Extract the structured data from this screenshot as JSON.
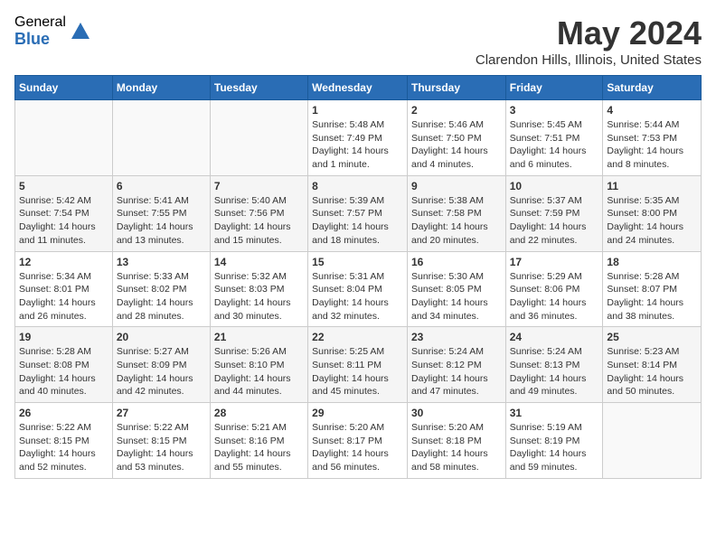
{
  "logo": {
    "general": "General",
    "blue": "Blue"
  },
  "title": "May 2024",
  "location": "Clarendon Hills, Illinois, United States",
  "weekdays": [
    "Sunday",
    "Monday",
    "Tuesday",
    "Wednesday",
    "Thursday",
    "Friday",
    "Saturday"
  ],
  "weeks": [
    [
      {
        "day": "",
        "info": ""
      },
      {
        "day": "",
        "info": ""
      },
      {
        "day": "",
        "info": ""
      },
      {
        "day": "1",
        "info": "Sunrise: 5:48 AM\nSunset: 7:49 PM\nDaylight: 14 hours\nand 1 minute."
      },
      {
        "day": "2",
        "info": "Sunrise: 5:46 AM\nSunset: 7:50 PM\nDaylight: 14 hours\nand 4 minutes."
      },
      {
        "day": "3",
        "info": "Sunrise: 5:45 AM\nSunset: 7:51 PM\nDaylight: 14 hours\nand 6 minutes."
      },
      {
        "day": "4",
        "info": "Sunrise: 5:44 AM\nSunset: 7:53 PM\nDaylight: 14 hours\nand 8 minutes."
      }
    ],
    [
      {
        "day": "5",
        "info": "Sunrise: 5:42 AM\nSunset: 7:54 PM\nDaylight: 14 hours\nand 11 minutes."
      },
      {
        "day": "6",
        "info": "Sunrise: 5:41 AM\nSunset: 7:55 PM\nDaylight: 14 hours\nand 13 minutes."
      },
      {
        "day": "7",
        "info": "Sunrise: 5:40 AM\nSunset: 7:56 PM\nDaylight: 14 hours\nand 15 minutes."
      },
      {
        "day": "8",
        "info": "Sunrise: 5:39 AM\nSunset: 7:57 PM\nDaylight: 14 hours\nand 18 minutes."
      },
      {
        "day": "9",
        "info": "Sunrise: 5:38 AM\nSunset: 7:58 PM\nDaylight: 14 hours\nand 20 minutes."
      },
      {
        "day": "10",
        "info": "Sunrise: 5:37 AM\nSunset: 7:59 PM\nDaylight: 14 hours\nand 22 minutes."
      },
      {
        "day": "11",
        "info": "Sunrise: 5:35 AM\nSunset: 8:00 PM\nDaylight: 14 hours\nand 24 minutes."
      }
    ],
    [
      {
        "day": "12",
        "info": "Sunrise: 5:34 AM\nSunset: 8:01 PM\nDaylight: 14 hours\nand 26 minutes."
      },
      {
        "day": "13",
        "info": "Sunrise: 5:33 AM\nSunset: 8:02 PM\nDaylight: 14 hours\nand 28 minutes."
      },
      {
        "day": "14",
        "info": "Sunrise: 5:32 AM\nSunset: 8:03 PM\nDaylight: 14 hours\nand 30 minutes."
      },
      {
        "day": "15",
        "info": "Sunrise: 5:31 AM\nSunset: 8:04 PM\nDaylight: 14 hours\nand 32 minutes."
      },
      {
        "day": "16",
        "info": "Sunrise: 5:30 AM\nSunset: 8:05 PM\nDaylight: 14 hours\nand 34 minutes."
      },
      {
        "day": "17",
        "info": "Sunrise: 5:29 AM\nSunset: 8:06 PM\nDaylight: 14 hours\nand 36 minutes."
      },
      {
        "day": "18",
        "info": "Sunrise: 5:28 AM\nSunset: 8:07 PM\nDaylight: 14 hours\nand 38 minutes."
      }
    ],
    [
      {
        "day": "19",
        "info": "Sunrise: 5:28 AM\nSunset: 8:08 PM\nDaylight: 14 hours\nand 40 minutes."
      },
      {
        "day": "20",
        "info": "Sunrise: 5:27 AM\nSunset: 8:09 PM\nDaylight: 14 hours\nand 42 minutes."
      },
      {
        "day": "21",
        "info": "Sunrise: 5:26 AM\nSunset: 8:10 PM\nDaylight: 14 hours\nand 44 minutes."
      },
      {
        "day": "22",
        "info": "Sunrise: 5:25 AM\nSunset: 8:11 PM\nDaylight: 14 hours\nand 45 minutes."
      },
      {
        "day": "23",
        "info": "Sunrise: 5:24 AM\nSunset: 8:12 PM\nDaylight: 14 hours\nand 47 minutes."
      },
      {
        "day": "24",
        "info": "Sunrise: 5:24 AM\nSunset: 8:13 PM\nDaylight: 14 hours\nand 49 minutes."
      },
      {
        "day": "25",
        "info": "Sunrise: 5:23 AM\nSunset: 8:14 PM\nDaylight: 14 hours\nand 50 minutes."
      }
    ],
    [
      {
        "day": "26",
        "info": "Sunrise: 5:22 AM\nSunset: 8:15 PM\nDaylight: 14 hours\nand 52 minutes."
      },
      {
        "day": "27",
        "info": "Sunrise: 5:22 AM\nSunset: 8:15 PM\nDaylight: 14 hours\nand 53 minutes."
      },
      {
        "day": "28",
        "info": "Sunrise: 5:21 AM\nSunset: 8:16 PM\nDaylight: 14 hours\nand 55 minutes."
      },
      {
        "day": "29",
        "info": "Sunrise: 5:20 AM\nSunset: 8:17 PM\nDaylight: 14 hours\nand 56 minutes."
      },
      {
        "day": "30",
        "info": "Sunrise: 5:20 AM\nSunset: 8:18 PM\nDaylight: 14 hours\nand 58 minutes."
      },
      {
        "day": "31",
        "info": "Sunrise: 5:19 AM\nSunset: 8:19 PM\nDaylight: 14 hours\nand 59 minutes."
      },
      {
        "day": "",
        "info": ""
      }
    ]
  ]
}
